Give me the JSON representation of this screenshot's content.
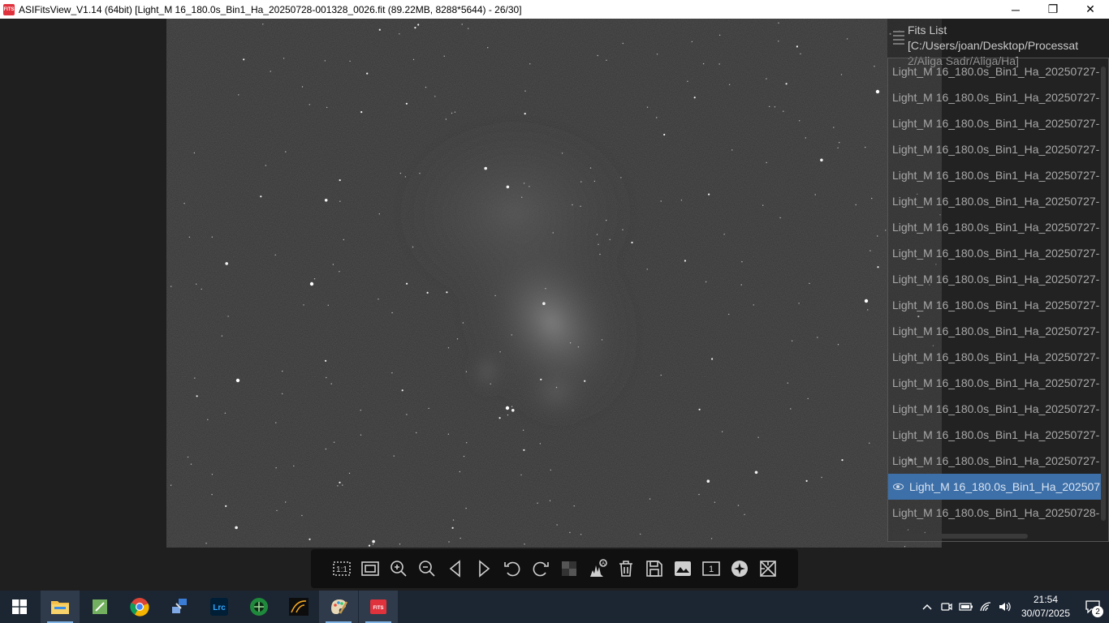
{
  "window": {
    "title": "ASIFitsView_V1.14 (64bit) [Light_M 16_180.0s_Bin1_Ha_20250728-001328_0026.fit (89.22MB, 8288*5644) - 26/30]",
    "app_icon_text": "FITS",
    "controls": {
      "minimize": "─",
      "maximize": "❐",
      "close": "✕"
    }
  },
  "fits_list": {
    "title": "Fits List [C:/Users/joan/Desktop/Processat 2/Aliga Sadr/Aliga/Ha]",
    "items": [
      {
        "label": "Light_M 16_180.0s_Bin1_Ha_20250727-",
        "selected": false
      },
      {
        "label": "Light_M 16_180.0s_Bin1_Ha_20250727-",
        "selected": false
      },
      {
        "label": "Light_M 16_180.0s_Bin1_Ha_20250727-",
        "selected": false
      },
      {
        "label": "Light_M 16_180.0s_Bin1_Ha_20250727-",
        "selected": false
      },
      {
        "label": "Light_M 16_180.0s_Bin1_Ha_20250727-",
        "selected": false
      },
      {
        "label": "Light_M 16_180.0s_Bin1_Ha_20250727-",
        "selected": false
      },
      {
        "label": "Light_M 16_180.0s_Bin1_Ha_20250727-",
        "selected": false
      },
      {
        "label": "Light_M 16_180.0s_Bin1_Ha_20250727-",
        "selected": false
      },
      {
        "label": "Light_M 16_180.0s_Bin1_Ha_20250727-",
        "selected": false
      },
      {
        "label": "Light_M 16_180.0s_Bin1_Ha_20250727-",
        "selected": false
      },
      {
        "label": "Light_M 16_180.0s_Bin1_Ha_20250727-",
        "selected": false
      },
      {
        "label": "Light_M 16_180.0s_Bin1_Ha_20250727-",
        "selected": false
      },
      {
        "label": "Light_M 16_180.0s_Bin1_Ha_20250727-",
        "selected": false
      },
      {
        "label": "Light_M 16_180.0s_Bin1_Ha_20250727-",
        "selected": false
      },
      {
        "label": "Light_M 16_180.0s_Bin1_Ha_20250727-",
        "selected": false
      },
      {
        "label": "Light_M 16_180.0s_Bin1_Ha_20250727-",
        "selected": false
      },
      {
        "label": "Light_M 16_180.0s_Bin1_Ha_202507",
        "selected": true
      },
      {
        "label": "Light_M 16_180.0s_Bin1_Ha_20250728-",
        "selected": false
      }
    ]
  },
  "toolbar": {
    "tools": [
      {
        "name": "actual-size-icon",
        "text": "1:1"
      },
      {
        "name": "fit-window-icon"
      },
      {
        "name": "zoom-in-icon"
      },
      {
        "name": "zoom-out-icon"
      },
      {
        "name": "previous-icon"
      },
      {
        "name": "next-icon"
      },
      {
        "name": "rotate-left-icon"
      },
      {
        "name": "rotate-right-icon"
      },
      {
        "name": "debayer-icon"
      },
      {
        "name": "auto-stretch-histogram-icon",
        "text": "A"
      },
      {
        "name": "delete-icon"
      },
      {
        "name": "save-icon"
      },
      {
        "name": "stretch-image-icon"
      },
      {
        "name": "single-frame-icon",
        "text": "1"
      },
      {
        "name": "star-detect-icon"
      },
      {
        "name": "crosshair-icon"
      }
    ]
  },
  "taskbar": {
    "apps": [
      {
        "name": "file-explorer-icon",
        "open": true
      },
      {
        "name": "notepad-icon"
      },
      {
        "name": "chrome-icon"
      },
      {
        "name": "network-app-icon"
      },
      {
        "name": "lightroom-classic-icon",
        "text": "Lrc"
      },
      {
        "name": "siril-icon"
      },
      {
        "name": "affinity-icon"
      },
      {
        "name": "paint-icon",
        "open": true
      },
      {
        "name": "asifitsview-icon",
        "text": "FITS",
        "active": true
      }
    ],
    "clock": {
      "time": "21:54",
      "date": "30/07/2025"
    },
    "notification_count": "2"
  },
  "colors": {
    "accent_selected": "#3d6fa8",
    "taskbar_bg": "#1c2633",
    "fits_icon": "#e0323c"
  }
}
